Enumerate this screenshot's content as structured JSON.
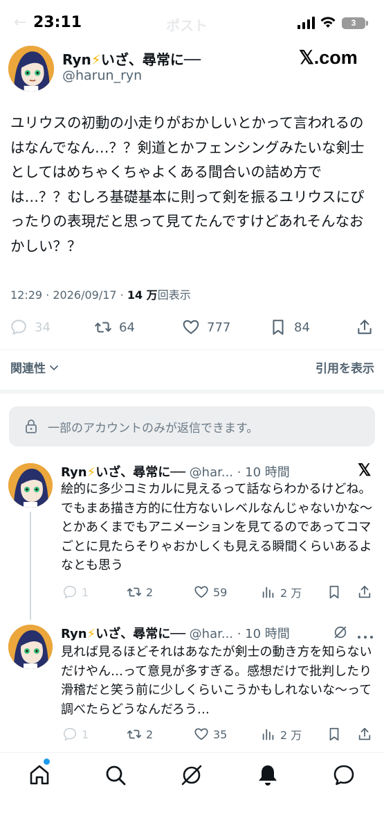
{
  "status_bar": {
    "time": "23:11",
    "battery": "3"
  },
  "ghost_header": {
    "back": "←",
    "title": "ポスト"
  },
  "main_tweet": {
    "author_name": "Ryn",
    "author_emoji": "⚡",
    "author_suffix": "いざ、尋常に──",
    "handle": "@harun_ryn",
    "brand": "𝕏.com",
    "text": "ユリウスの初動の小走りがおかしいとかって言われるのはなんでなん…？？剣道とかフェンシングみたいな剣士としてはめちゃくちゃよくある間合いの詰め方では…？？むしろ基礎基本に則って剣を振るユリウスにぴったりの表現だと思って見てたんですけどあれそんなおかしい？？",
    "time": "12:29 · 2026/09/17 · ",
    "views_count": "14 万",
    "views_label": "回表示",
    "counts": {
      "replies": "34",
      "reposts": "64",
      "likes": "777",
      "bookmarks": "84"
    }
  },
  "sort": {
    "related": "関連性",
    "quotes": "引用を表示"
  },
  "restriction_notice": "一部のアカウントのみが返信できます。",
  "replies": [
    {
      "author_name": "Ryn",
      "author_emoji": "⚡",
      "author_suffix": "いざ、尋常に──",
      "handle_time": " @har... · 10 時間",
      "text": "絵的に多少コミカルに見えるって話ならわかるけどね。でもまあ描き方的に仕方ないレベルなんじゃないかな〜とかあくまでもアニメーションを見てるのであってコマごとに見たらそりゃおかしくも見える瞬間くらいあるよなとも思う",
      "counts": {
        "replies": "1",
        "reposts": "2",
        "likes": "59",
        "views": "2 万"
      }
    },
    {
      "author_name": "Ryn",
      "author_emoji": "⚡",
      "author_suffix": "いざ、尋常に──",
      "handle_time": " @har... · 10 時間",
      "text": "見れば見るほどそれはあなたが剣士の動き方を知らないだけやん…って意見が多すぎる。感想だけで批判したり滑稽だと笑う前に少しくらいこうかもしれないな〜って調べたらどうなんだろう…",
      "counts": {
        "replies": "1",
        "reposts": "2",
        "likes": "35",
        "views": "2 万"
      }
    }
  ],
  "icons": {
    "reply": "reply-icon",
    "repost": "repost-icon",
    "like": "heart-icon",
    "bookmark": "bookmark-icon",
    "share": "share-icon",
    "views": "views-icon",
    "lock": "lock-icon",
    "x_logo": "x-logo-icon",
    "grok": "grok-icon",
    "more": "more-icon",
    "home": "home-icon",
    "search": "search-icon",
    "notifications": "bell-icon",
    "messages": "message-icon"
  },
  "colors": {
    "accent": "#1d9bf0",
    "text": "#0f1419",
    "muted": "#536471",
    "bolt": "#f5b400"
  }
}
